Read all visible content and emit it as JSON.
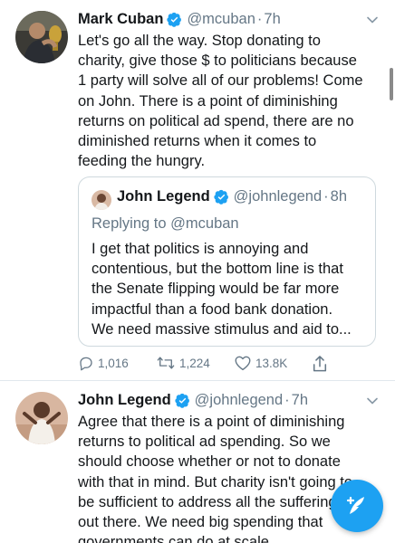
{
  "tweet1": {
    "name": "Mark Cuban",
    "handle": "@mcuban",
    "separator": "·",
    "time": "7h",
    "lines": [
      "Let's go all the way. Stop donating to",
      "charity, give those $ to politicians because",
      "1 party will solve all of our problems! Come",
      "on John. There is a point of diminishing",
      "returns on political ad spend, there are no",
      "diminished returns when it comes to",
      "feeding the hungry."
    ],
    "quote": {
      "name": "John Legend",
      "handle": "@johnlegend",
      "separator": "·",
      "time": "8h",
      "replying_prefix": "Replying to",
      "replying_to": "@mcuban",
      "lines": [
        "I get that politics is annoying and",
        "contentious, but the bottom line is that",
        "the Senate flipping would be far more",
        "impactful than a food bank donation.",
        "We need massive stimulus and aid to..."
      ]
    },
    "actions": {
      "replies": "1,016",
      "retweets": "1,224",
      "likes": "13.8K"
    }
  },
  "tweet2": {
    "name": "John Legend",
    "handle": "@johnlegend",
    "separator": "·",
    "time": "7h",
    "lines": [
      "Agree that there is a point of diminishing",
      "returns to political ad spending. So we",
      "should choose whether or not to donate",
      "with that in mind. But charity isn't going to",
      "be sufficient to address all the suffering",
      "out there. We need big spending that",
      "governments can do at scale"
    ]
  },
  "icons": {
    "verified": "verified-badge-icon",
    "caret": "chevron-down-icon",
    "reply": "reply-icon",
    "retweet": "retweet-icon",
    "like": "heart-icon",
    "share": "share-icon",
    "compose": "compose-tweet-icon"
  },
  "colors": {
    "brand": "#1da1f2",
    "text": "#14171a",
    "secondary": "#657786"
  }
}
